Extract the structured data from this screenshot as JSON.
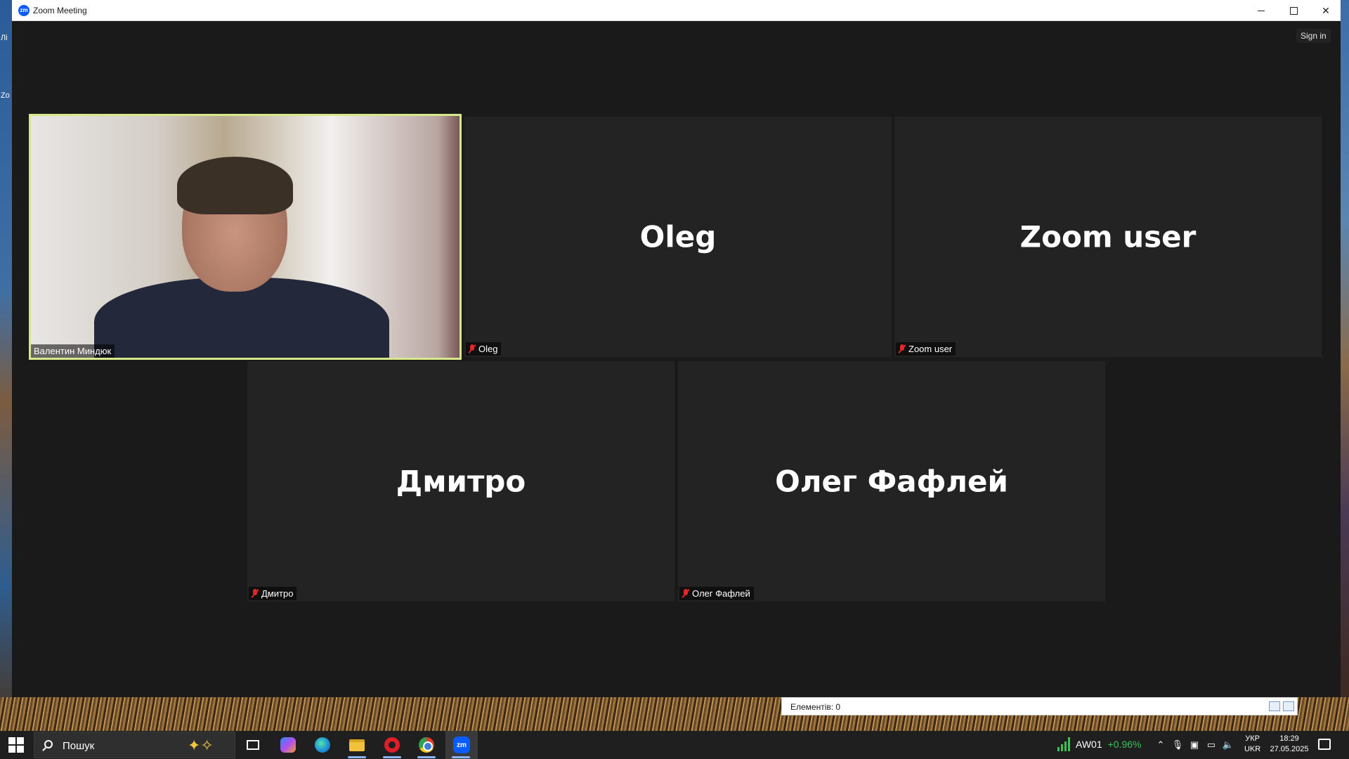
{
  "window": {
    "title": "Zoom Meeting",
    "app_icon_text": "zm",
    "sign_in_label": "Sign in"
  },
  "participants": [
    {
      "display_name": "Валентин Миндюк",
      "label": "Валентин Миндюк",
      "video_on": true,
      "muted": false,
      "active_speaker": true
    },
    {
      "display_name": "Oleg",
      "label": "Oleg",
      "video_on": false,
      "muted": true
    },
    {
      "display_name": "Zoom user",
      "label": "Zoom user",
      "video_on": false,
      "muted": true
    },
    {
      "display_name": "Дмитро",
      "label": "Дмитро",
      "video_on": false,
      "muted": true
    },
    {
      "display_name": "Олег Фафлей",
      "label": "Олег Фафлей",
      "video_on": false,
      "muted": true
    }
  ],
  "explorer_footer": {
    "items_count": "Елементів: 0"
  },
  "taskbar": {
    "search_placeholder": "Пошук",
    "apps": [
      {
        "name": "task-view",
        "icon": "task-view-icon"
      },
      {
        "name": "copilot",
        "icon": "copilot-icon"
      },
      {
        "name": "edge",
        "icon": "edge-icon"
      },
      {
        "name": "file-explorer",
        "icon": "folder-icon"
      },
      {
        "name": "opera",
        "icon": "opera-icon"
      },
      {
        "name": "chrome",
        "icon": "chrome-icon"
      },
      {
        "name": "zoom",
        "icon": "zoom-icon",
        "label": "zm"
      }
    ],
    "stock": {
      "ticker": "AW01",
      "change": "+0.96%"
    },
    "language_top": "УКР",
    "language_bottom": "UKR",
    "time": "18:29",
    "date": "27.05.2025"
  },
  "colors": {
    "active_speaker_border": "#d7e88a",
    "muted_mic": "#e02828",
    "zoom_blue": "#0b5cff",
    "stock_up": "#3cc15a"
  }
}
